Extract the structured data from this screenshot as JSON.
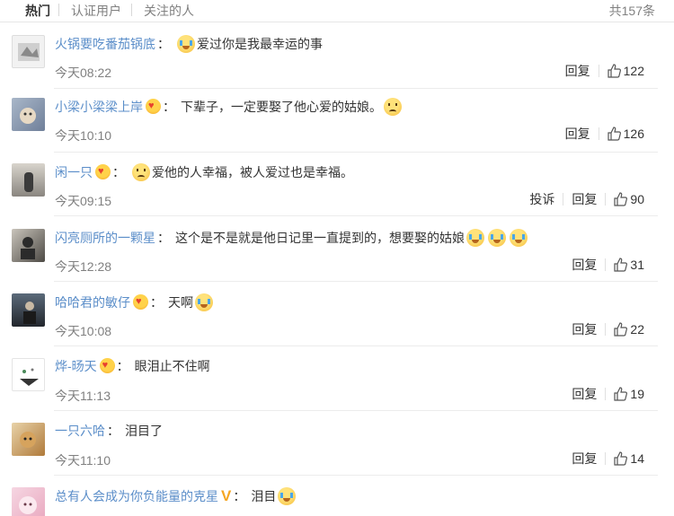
{
  "tabs": [
    {
      "label": "热门"
    },
    {
      "label": "认证用户"
    },
    {
      "label": "关注的人"
    }
  ],
  "total": "共157条",
  "actions": {
    "reply": "回复",
    "report": "投诉"
  },
  "comments": [
    {
      "user": "火锅要吃番茄锅底",
      "text": "爱过你是我最幸运的事",
      "time": "今天08:22",
      "likes": "122"
    },
    {
      "user": "小梁小梁梁上岸",
      "text": "下辈子，一定要娶了他心爱的姑娘。",
      "time": "今天10:10",
      "likes": "126"
    },
    {
      "user": "闲一只",
      "text": "爱他的人幸福，被人爱过也是幸福。",
      "time": "今天09:15",
      "likes": "90"
    },
    {
      "user": "闪亮厕所的一颗星",
      "text": "这个是不是就是他日记里一直提到的，想要娶的姑娘",
      "time": "今天12:28",
      "likes": "31"
    },
    {
      "user": "哈哈君的敏仔",
      "text": "天啊",
      "time": "今天10:08",
      "likes": "22"
    },
    {
      "user": "烨-旸天",
      "text": "眼泪止不住啊",
      "time": "今天11:13",
      "likes": "19"
    },
    {
      "user": "一只六哈",
      "text": "泪目了",
      "time": "今天11:10",
      "likes": "14"
    },
    {
      "user": "总有人会成为你负能量的克星",
      "text": "泪目",
      "time": "",
      "likes": ""
    }
  ]
}
